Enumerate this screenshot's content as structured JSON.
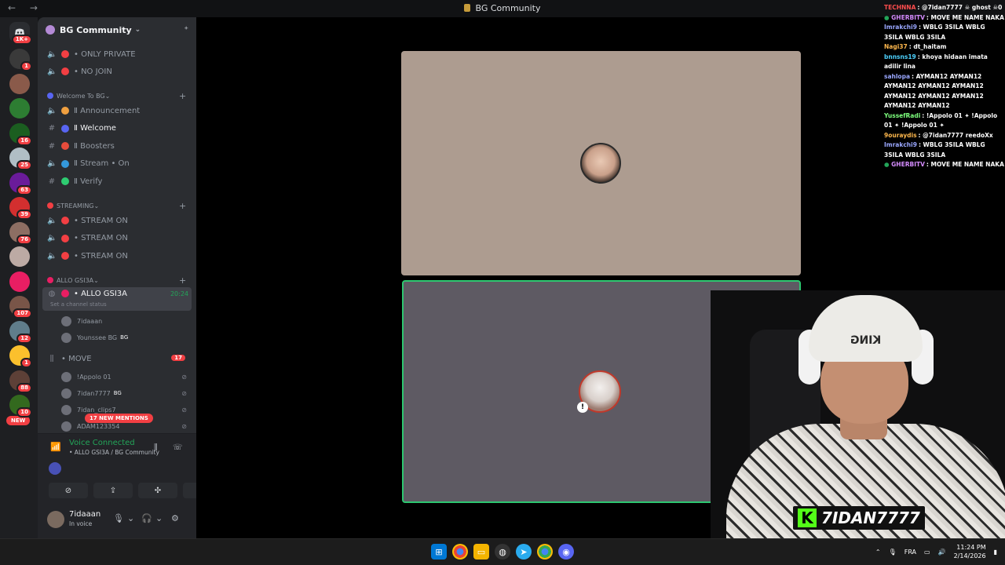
{
  "window": {
    "title": "BG Community",
    "back": "←",
    "forward": "→"
  },
  "rail": {
    "home_badge": "1K+",
    "servers": [
      {
        "color": "#3a3a3a",
        "badge": "1"
      },
      {
        "color": "#8a5a4a",
        "badge": ""
      },
      {
        "color": "#2d7d32",
        "badge": ""
      },
      {
        "color": "#1b5e20",
        "badge": "16"
      },
      {
        "color": "#b0bec5",
        "badge": "25"
      },
      {
        "color": "#6a1b9a",
        "badge": "63"
      },
      {
        "color": "#d32f2f",
        "badge": "39"
      },
      {
        "color": "#8d6e63",
        "badge": "76"
      },
      {
        "color": "#bcaaa4",
        "badge": ""
      },
      {
        "color": "#e91e63",
        "badge": ""
      },
      {
        "color": "#795548",
        "badge": "107"
      },
      {
        "color": "#607d8b",
        "badge": "12"
      },
      {
        "color": "#fbc02d",
        "badge": "1"
      },
      {
        "color": "#5d4037",
        "badge": "88"
      },
      {
        "color": "#33691e",
        "badge": "10"
      }
    ],
    "new_label": "NEW"
  },
  "guild": {
    "name": "BG Community"
  },
  "channels": {
    "top": [
      {
        "label": "• ONLY PRIVATE"
      },
      {
        "label": "• NO JOIN"
      }
    ],
    "cat_welcome": "Welcome To BG",
    "welcome": [
      {
        "label": "Ⅱ Announcement"
      },
      {
        "label": "Ⅱ Welcome"
      },
      {
        "label": "Ⅱ Boosters"
      },
      {
        "label": "Ⅱ Stream • On"
      },
      {
        "label": "Ⅱ Verify"
      }
    ],
    "cat_streaming": "STREAMING",
    "streaming": [
      {
        "label": "• STREAM ON"
      },
      {
        "label": "• STREAM ON"
      },
      {
        "label": "• STREAM ON"
      }
    ],
    "cat_allo": "ALLO GSI3A",
    "allo": {
      "label": "• ALLO GSI3A",
      "timer": "20:24",
      "status": "Set a channel status"
    },
    "allo_users": [
      {
        "name": "7idaaan",
        "tag": ""
      },
      {
        "name": "Younssee BG",
        "tag": "BG"
      }
    ],
    "move": {
      "label": "• MOVE",
      "count": "17"
    },
    "move_users": [
      {
        "name": "!Appolo 01",
        "tag": ""
      },
      {
        "name": "7idan7777",
        "tag": "BG"
      },
      {
        "name": "7idan_clips7",
        "tag": ""
      },
      {
        "name": "ADAM123354",
        "tag": ""
      }
    ],
    "mentions": "17 NEW MENTIONS"
  },
  "voice": {
    "title": "Voice Connected",
    "sub": "• ALLO GSI3A / BG Community"
  },
  "user": {
    "name": "7idaaan",
    "status": "In voice"
  },
  "chat": [
    {
      "user": "TECHNNA",
      "color": "#ff4d4d",
      "msg": ": @7idan7777 ☠ ghost ☠0"
    },
    {
      "user": "GHERBITV",
      "color": "#d58cff",
      "msg": ": MOVE ME NAME NAKA",
      "dot": true
    },
    {
      "user": "Imrakchi9",
      "color": "#9aa7ff",
      "msg": ": WBLG 3SILA WBLG 3SILA WBLG 3SILA"
    },
    {
      "user": "Nagi37",
      "color": "#ffb84d",
      "msg": ": dt_haitam"
    },
    {
      "user": "bnnsns19",
      "color": "#4dd2ff",
      "msg": ": khoya hidaan imata adilir lina"
    },
    {
      "user": "sahlopa",
      "color": "#9aa7ff",
      "msg": ": AYMAN12 AYMAN12 AYMAN12 AYMAN12 AYMAN12 AYMAN12 AYMAN12 AYMAN12 AYMAN12 AYMAN12"
    },
    {
      "user": "YussefRadi",
      "color": "#7dff7d",
      "msg": ": !Appolo 01 ✦ !Appolo 01 ✦ !Appolo 01 ✦"
    },
    {
      "user": "9ouraydis",
      "color": "#ffb84d",
      "msg": ": @7idan7777 reedoXx"
    },
    {
      "user": "Imrakchi9",
      "color": "#9aa7ff",
      "msg": ": WBLG 3SILA WBLG 3SILA WBLG 3SILA"
    },
    {
      "user": "GHERBITV",
      "color": "#d58cff",
      "msg": ": MOVE ME NAME NAKA",
      "dot": true
    }
  ],
  "cam": {
    "beanie_text": "KING",
    "tag": "7IDAN7777",
    "k": "K"
  },
  "taskbar": {
    "lang": "FRA",
    "time": "11:24 PM",
    "date": "2/14/2026"
  }
}
